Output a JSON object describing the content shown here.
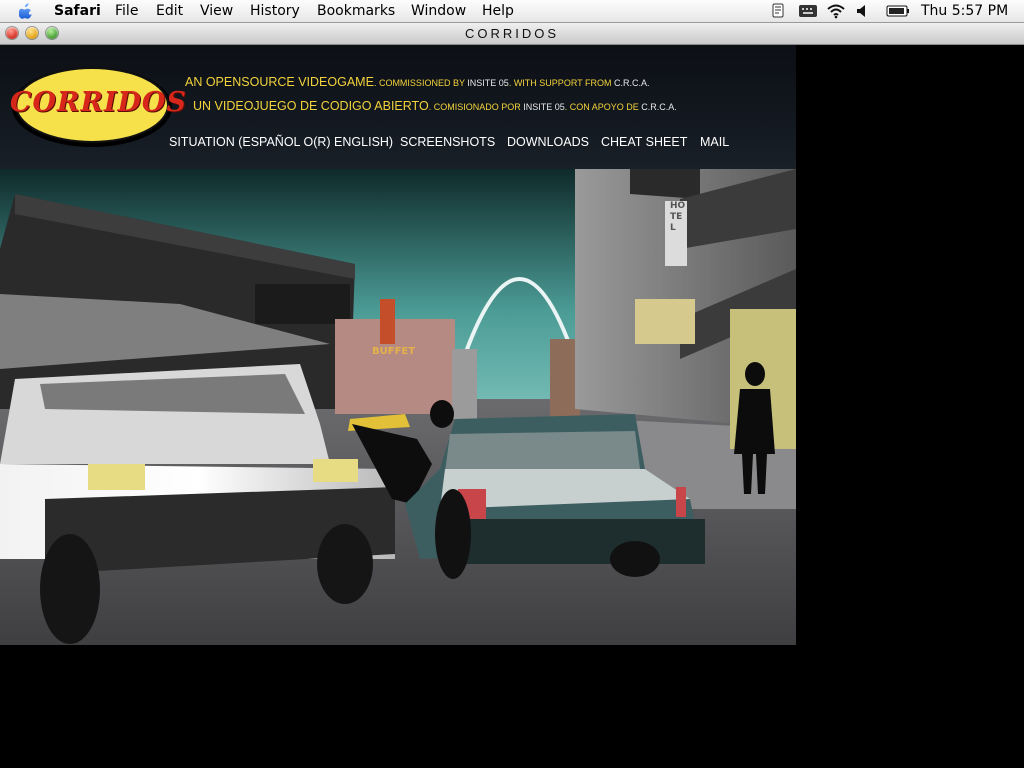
{
  "menubar": {
    "app_name": "Safari",
    "items": [
      "File",
      "Edit",
      "View",
      "History",
      "Bookmarks",
      "Window",
      "Help"
    ],
    "clock": "Thu 5:57 PM"
  },
  "window": {
    "title": "CORRIDOS"
  },
  "site": {
    "logo_text": "CORRIDOS",
    "tagline_en": {
      "main": "AN OPENSOURCE VIDEOGAME",
      "p1": ". COMMISSIONED BY ",
      "p2": "INSITE 05",
      "p3": ". WITH SUPPORT FROM ",
      "p4": "C.R.C.A."
    },
    "tagline_es": {
      "main": "UN VIDEOJUEGO DE CODIGO ABIERTO",
      "p1": ". COMISIONADO POR ",
      "p2": "INSITE 05",
      "p3": ". CON APOYO DE ",
      "p4": "C.R.C.A."
    },
    "nav": [
      "SITUATION (ESPAÑOL O(R) ENGLISH)",
      "SCREENSHOTS",
      "DOWNLOADS",
      "CHEAT SHEET",
      "MAIL"
    ],
    "scene_signs": {
      "buffet": "BUFFET",
      "hotel": "HOTEL"
    }
  }
}
